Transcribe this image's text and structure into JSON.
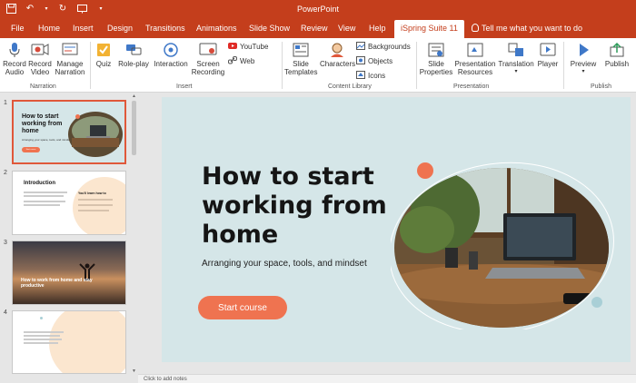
{
  "app_title": "PowerPoint",
  "menu_tabs": [
    "File",
    "Home",
    "Insert",
    "Design",
    "Transitions",
    "Animations",
    "Slide Show",
    "Review",
    "View",
    "Help",
    "iSpring Suite 11"
  ],
  "tell_me": "Tell me what you want to do",
  "ribbon": {
    "narration": {
      "label": "Narration",
      "buttons": [
        {
          "line1": "Record",
          "line2": "Audio"
        },
        {
          "line1": "Record",
          "line2": "Video"
        },
        {
          "line1": "Manage",
          "line2": "Narration"
        }
      ]
    },
    "insert": {
      "label": "Insert",
      "buttons": [
        {
          "line1": "Quiz"
        },
        {
          "line1": "Role-play"
        },
        {
          "line1": "Interaction"
        },
        {
          "line1": "Screen",
          "line2": "Recording"
        }
      ],
      "small": [
        "YouTube",
        "Web"
      ]
    },
    "content_library": {
      "label": "Content Library",
      "buttons": [
        {
          "line1": "Slide",
          "line2": "Templates"
        },
        {
          "line1": "Characters"
        }
      ],
      "small": [
        "Backgrounds",
        "Objects",
        "Icons"
      ]
    },
    "presentation": {
      "label": "Presentation",
      "buttons": [
        {
          "line1": "Slide",
          "line2": "Properties"
        },
        {
          "line1": "Presentation",
          "line2": "Resources"
        },
        {
          "line1": "Translation"
        },
        {
          "line1": "Player"
        }
      ]
    },
    "publish": {
      "label": "Publish",
      "buttons": [
        {
          "line1": "Preview"
        },
        {
          "line1": "Publish"
        }
      ]
    }
  },
  "thumbnails": [
    {
      "num": "1",
      "title": "How to start working from home",
      "subtitle": "Arranging your space, tools, and mindset",
      "button": "Start course"
    },
    {
      "num": "2",
      "title": "Introduction",
      "side": "You'll learn how to"
    },
    {
      "num": "3",
      "title": "How to work from home and stay productive"
    },
    {
      "num": "4"
    }
  ],
  "slide": {
    "title": "How to start working from home",
    "subtitle": "Arranging your space, tools, and mindset",
    "button": "Start course"
  },
  "notes_placeholder": "Click to add notes",
  "colors": {
    "accent": "#c43e1c",
    "slide_bg": "#d5e6e8",
    "button": "#ef7350",
    "dot_blue": "#a9cfd6"
  }
}
